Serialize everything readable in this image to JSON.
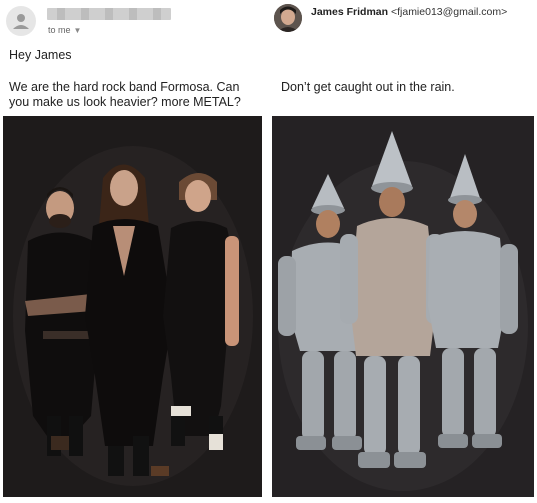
{
  "left_email": {
    "avatar_icon": "person-icon",
    "recipient": "to me",
    "greeting": "Hey James",
    "message": "We are the hard rock band Formosa. Can you make us look heavier? more METAL?",
    "photo": "band-photo"
  },
  "right_email": {
    "avatar_icon": "profile-photo",
    "sender_name": "James Fridman",
    "sender_email": "<fjamie013@gmail.com>",
    "reply": "Don’t get caught out in the rain.",
    "photo": "tin-men-photo"
  },
  "colors": {
    "text": "#222222",
    "meta_text": "#666666",
    "photo_background": "#1d1a1a",
    "tin_metal": "#a9adb2"
  }
}
